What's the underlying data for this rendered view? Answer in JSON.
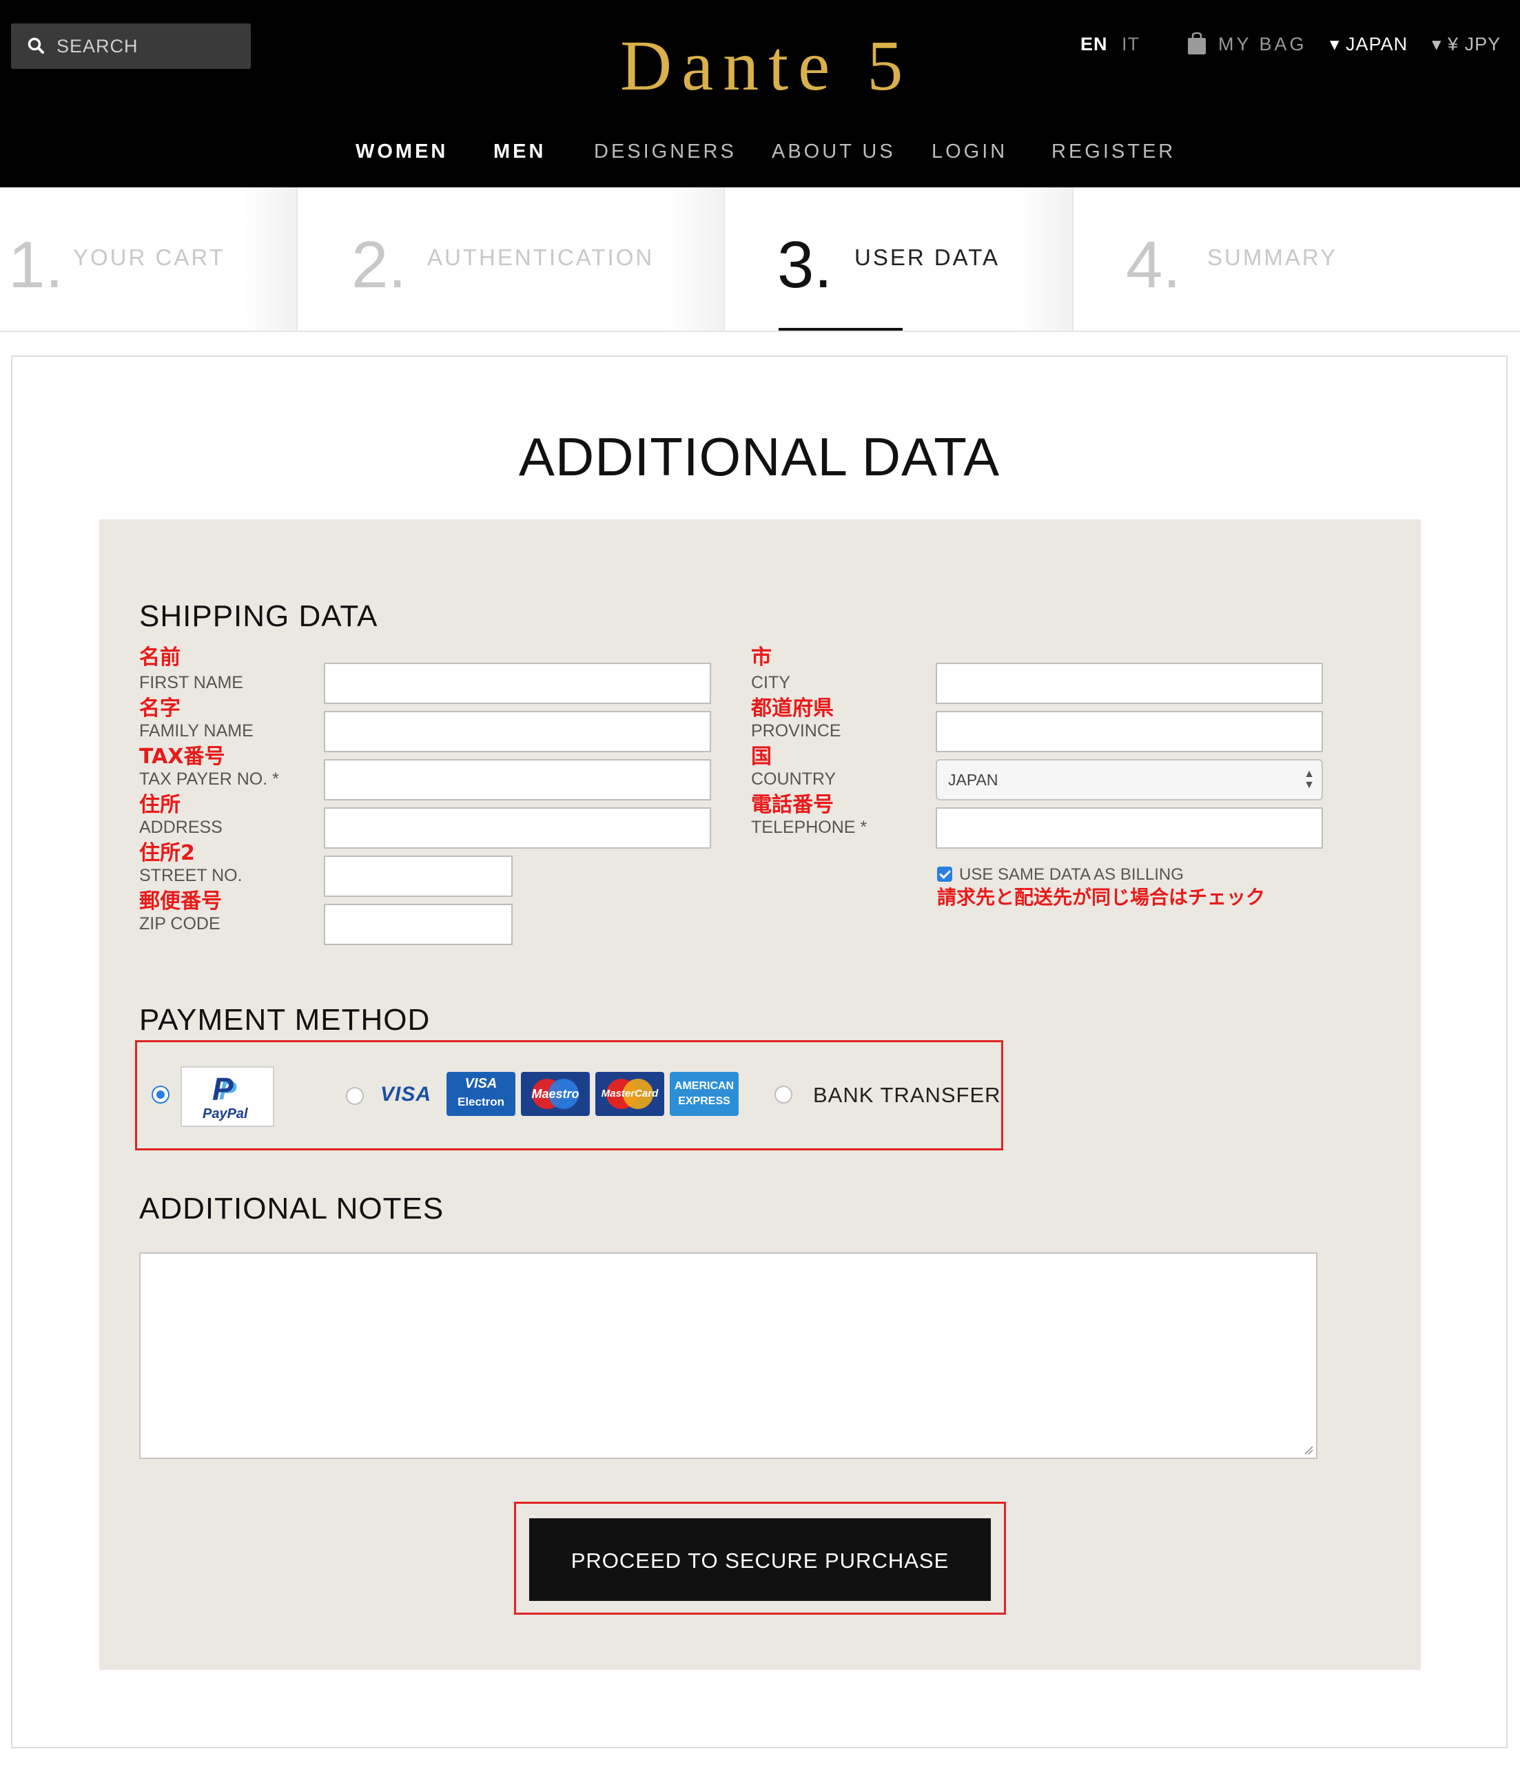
{
  "header": {
    "search_placeholder": "SEARCH",
    "logo": "Dante 5",
    "lang_en": "EN",
    "lang_it": "IT",
    "bag_label": "MY BAG",
    "country": "▾ JAPAN",
    "currency": "▾  ¥ JPY",
    "nav": [
      "WOMEN",
      "MEN",
      "DESIGNERS",
      "ABOUT US",
      "LOGIN",
      "REGISTER"
    ]
  },
  "steps": [
    {
      "num": "1.",
      "label": "YOUR CART"
    },
    {
      "num": "2.",
      "label": "AUTHENTICATION"
    },
    {
      "num": "3.",
      "label": "USER DATA"
    },
    {
      "num": "4.",
      "label": "SUMMARY"
    }
  ],
  "page_title": "ADDITIONAL DATA",
  "shipping": {
    "title": "SHIPPING DATA",
    "left_fields": [
      {
        "jp": "名前",
        "en": "FIRST NAME"
      },
      {
        "jp": "名字",
        "en": "FAMILY NAME"
      },
      {
        "jp": "TAX番号",
        "en": "TAX PAYER NO. *"
      },
      {
        "jp": "住所",
        "en": "ADDRESS"
      },
      {
        "jp": "住所2",
        "en": "STREET NO."
      },
      {
        "jp": "郵便番号",
        "en": "ZIP CODE"
      }
    ],
    "right_fields": [
      {
        "jp": "市",
        "en": "CITY"
      },
      {
        "jp": "都道府県",
        "en": "PROVINCE"
      },
      {
        "jp": "国",
        "en": "COUNTRY"
      },
      {
        "jp": "電話番号",
        "en": "TELEPHONE *"
      }
    ],
    "country_value": "JAPAN",
    "same_billing_label": "USE SAME DATA AS BILLING",
    "same_billing_note": "請求先と配送先が同じ場合はチェック"
  },
  "payment": {
    "title": "PAYMENT METHOD",
    "paypal_text": "PayPal",
    "visa_text": "VISA",
    "card_logos": [
      "VISA Electron",
      "Maestro",
      "MasterCard",
      "AMERICAN EXPRESS"
    ],
    "bank_label": "BANK TRANSFER"
  },
  "notes": {
    "title": "ADDITIONAL NOTES"
  },
  "cta": {
    "label": "PROCEED TO SECURE PURCHASE"
  },
  "colors": {
    "accent_red": "#e81a1a",
    "logo_gold": "#d9b04a",
    "panel_bg": "#ebe8e1",
    "checkbox_blue": "#2a7de1"
  }
}
